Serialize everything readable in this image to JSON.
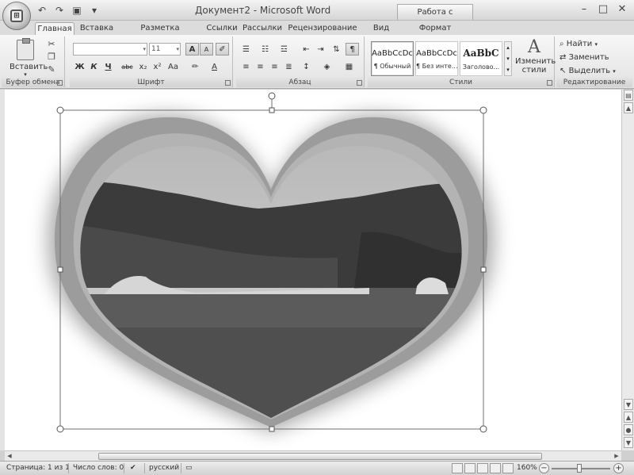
{
  "window": {
    "title": "Документ2 - Microsoft Word",
    "context_tab_header": "Работа с рисунками"
  },
  "tabs": [
    {
      "label": "Главная",
      "active": true
    },
    {
      "label": "Вставка",
      "active": false
    },
    {
      "label": "Разметка страницы",
      "active": false
    },
    {
      "label": "Ссылки",
      "active": false
    },
    {
      "label": "Рассылки",
      "active": false
    },
    {
      "label": "Рецензирование",
      "active": false
    },
    {
      "label": "Вид",
      "active": false
    },
    {
      "label": "Формат",
      "active": false
    }
  ],
  "ribbon": {
    "clipboard": {
      "label": "Буфер обмена",
      "paste_label": "Вставить"
    },
    "font": {
      "label": "Шрифт",
      "font_name": "",
      "font_size": "11",
      "bold": "Ж",
      "italic": "К",
      "underline": "Ч",
      "strike": "abc",
      "subscript": "x₂",
      "superscript": "x²",
      "change_case": "Aa",
      "grow": "A",
      "shrink": "A",
      "font_color": "A"
    },
    "paragraph": {
      "label": "Абзац",
      "pilcrow": "¶"
    },
    "styles": {
      "label": "Стили",
      "items": [
        {
          "sample": "AaBbCcDc",
          "name": "¶ Обычный"
        },
        {
          "sample": "AaBbCcDc",
          "name": "¶ Без инте..."
        },
        {
          "sample": "AaBbC",
          "name": "Заголово..."
        }
      ],
      "change_styles_line1": "Изменить",
      "change_styles_line2": "стили"
    },
    "editing": {
      "label": "Редактирование",
      "find": "Найти",
      "replace": "Заменить",
      "select": "Выделить"
    }
  },
  "statusbar": {
    "page": "Страница: 1 из 1",
    "words": "Число слов: 0",
    "language": "русский",
    "zoom": "160%"
  },
  "colors": {
    "ribbon_bg": "#e8e8e8",
    "heart_frame": "#9a9a9a",
    "selection_handle": "#ffffff"
  }
}
